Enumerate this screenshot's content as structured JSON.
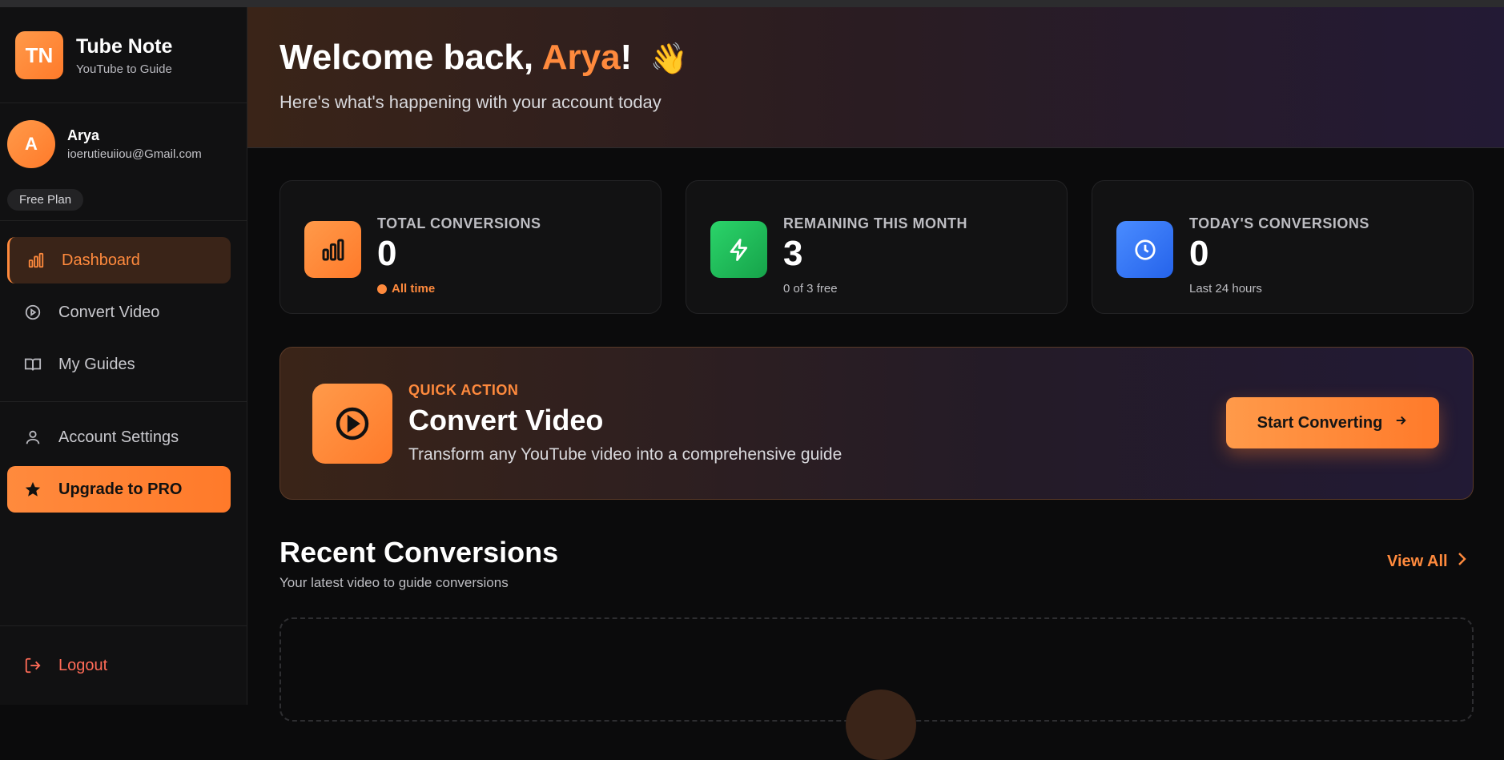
{
  "brand": {
    "logo": "TN",
    "name": "Tube Note",
    "tagline": "YouTube to Guide"
  },
  "user": {
    "initial": "A",
    "name": "Arya",
    "email": "ioerutieuiiou@Gmail.com",
    "plan": "Free Plan"
  },
  "nav": {
    "items": [
      {
        "label": "Dashboard",
        "icon": "bar-chart-icon"
      },
      {
        "label": "Convert Video",
        "icon": "play-circle-icon"
      },
      {
        "label": "My Guides",
        "icon": "book-icon"
      }
    ],
    "account": "Account Settings",
    "upgrade": "Upgrade to PRO",
    "logout": "Logout"
  },
  "hero": {
    "greeting": "Welcome back, ",
    "name": "Arya",
    "exclaim": "!",
    "emoji": "👋",
    "subtitle": "Here's what's happening with your account today"
  },
  "stats": [
    {
      "label": "TOTAL CONVERSIONS",
      "value": "0",
      "foot": "All time",
      "icon": "bar-chart-icon",
      "color": "#ff8a3d"
    },
    {
      "label": "REMAINING THIS MONTH",
      "value": "3",
      "foot": "0 of 3 free",
      "icon": "lightning-icon",
      "color": "#22c55e"
    },
    {
      "label": "TODAY'S CONVERSIONS",
      "value": "0",
      "foot": "Last 24 hours",
      "icon": "clock-icon",
      "color": "#3b82f6"
    }
  ],
  "quick_action": {
    "kicker": "QUICK ACTION",
    "title": "Convert Video",
    "description": "Transform any YouTube video into a comprehensive guide",
    "button": "Start Converting"
  },
  "recent": {
    "title": "Recent Conversions",
    "subtitle": "Your latest video to guide conversions",
    "view_all": "View All"
  }
}
